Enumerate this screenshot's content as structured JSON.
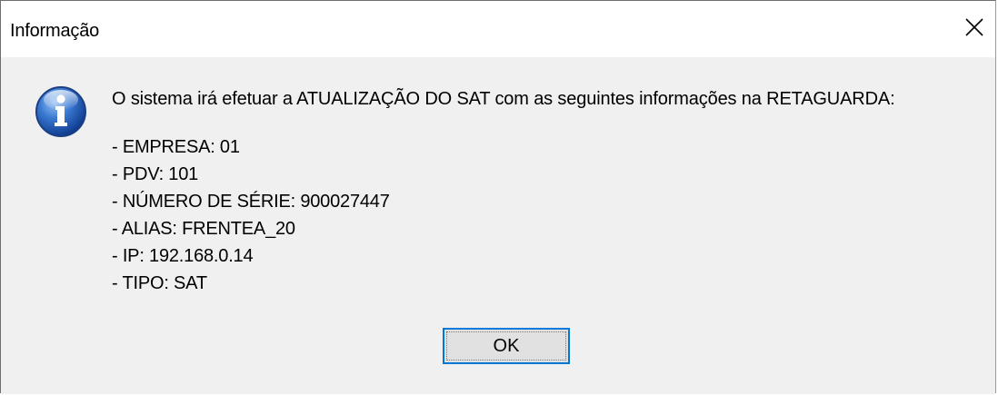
{
  "window": {
    "title": "Informação",
    "close_icon": "close-icon"
  },
  "content": {
    "icon": "info-icon",
    "message": "O sistema irá efetuar a ATUALIZAÇÃO DO SAT com as seguintes informações na RETAGUARDA:",
    "details": [
      "- EMPRESA: 01",
      "- PDV: 101",
      "- NÚMERO DE SÉRIE: 900027447",
      "- ALIAS: FRENTEA_20",
      "- IP: 192.168.0.14",
      "- TIPO: SAT"
    ]
  },
  "buttons": {
    "ok_label": "OK"
  },
  "colors": {
    "focus_border": "#0078d7",
    "dialog_background": "#f0f0f0",
    "titlebar_background": "#ffffff"
  }
}
